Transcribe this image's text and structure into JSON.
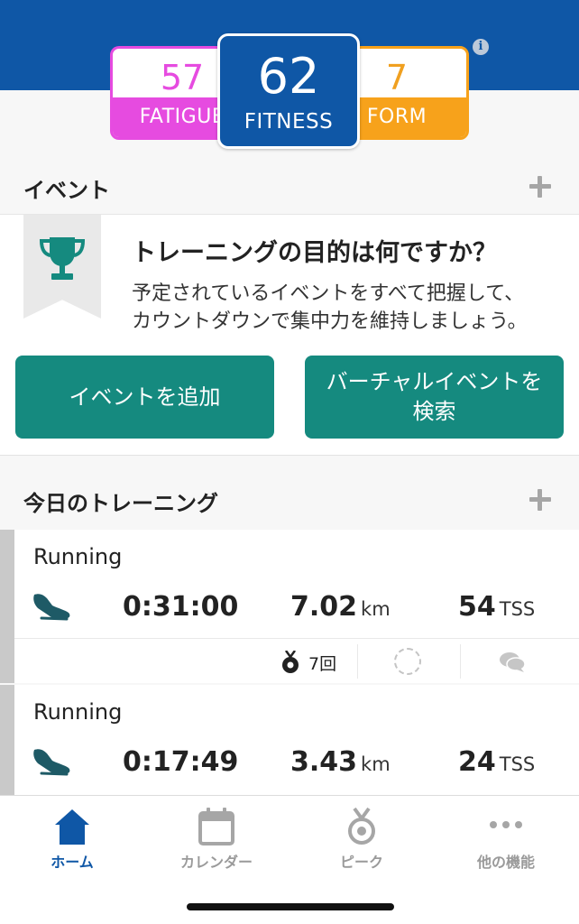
{
  "metrics": {
    "fatigue": {
      "value": "57",
      "label": "FATIGUE",
      "color": "#e64be0"
    },
    "fitness": {
      "value": "62",
      "label": "FITNESS",
      "color": "#0f57a6"
    },
    "form": {
      "value": "7",
      "label": "FORM",
      "color": "#f7a21b"
    }
  },
  "events_section": {
    "title": "イベント",
    "heading": "トレーニングの目的は何ですか？",
    "description_lines": [
      "予定されているイベントをすべて把握して、",
      "カウントダウンで集中力を維持しましょう。"
    ],
    "add_button": "イベントを追加",
    "virtual_button_lines": [
      "バーチャルイベントを",
      "検索"
    ]
  },
  "training_section": {
    "title": "今日のトレーニング",
    "workouts": [
      {
        "type": "Running",
        "duration": "0:31:00",
        "distance": "7.02",
        "distance_unit": "km",
        "tss": "54",
        "tss_unit": "TSS",
        "medals": "7回"
      },
      {
        "type": "Running",
        "duration": "0:17:49",
        "distance": "3.43",
        "distance_unit": "km",
        "tss": "24",
        "tss_unit": "TSS"
      }
    ]
  },
  "tabbar": {
    "items": [
      {
        "label": "ホーム",
        "icon": "home-icon",
        "active": true
      },
      {
        "label": "カレンダー",
        "icon": "calendar-icon",
        "active": false
      },
      {
        "label": "ピーク",
        "icon": "peak-medal-icon",
        "active": false
      },
      {
        "label": "他の機能",
        "icon": "more-icon",
        "active": false
      }
    ]
  },
  "colors": {
    "brand_blue": "#0f57a6",
    "teal": "#158a7f",
    "accent_pink": "#e64be0",
    "accent_orange": "#f7a21b"
  }
}
